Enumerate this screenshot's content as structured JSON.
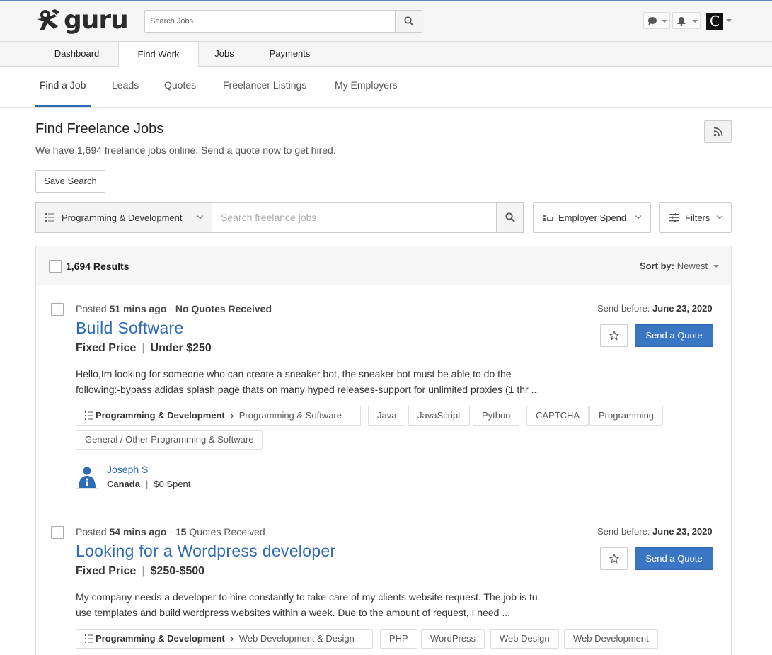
{
  "header": {
    "logo_text": "guru",
    "search_placeholder": "Search Jobs",
    "avatar_letter": "C"
  },
  "main_tabs": [
    {
      "label": "Dashboard",
      "active": false
    },
    {
      "label": "Find Work",
      "active": true
    },
    {
      "label": "Jobs",
      "active": false
    },
    {
      "label": "Payments",
      "active": false
    }
  ],
  "sub_tabs": [
    {
      "label": "Find a Job",
      "active": true
    },
    {
      "label": "Leads",
      "active": false
    },
    {
      "label": "Quotes",
      "active": false
    },
    {
      "label": "Freelancer Listings",
      "active": false
    },
    {
      "label": "My Employers",
      "active": false
    }
  ],
  "page": {
    "title": "Find Freelance Jobs",
    "subtitle": "We have 1,694 freelance jobs online. Send a quote now to get hired.",
    "save_search_label": "Save Search"
  },
  "filters": {
    "category": "Programming & Development",
    "search_placeholder": "Search freelance jobs",
    "employer_spend_label": "Employer Spend",
    "filters_label": "Filters"
  },
  "results": {
    "count_label": "1,694 Results",
    "sort_label": "Sort by:",
    "sort_value": "Newest"
  },
  "jobs": [
    {
      "posted_prefix": "Posted",
      "posted_time": "51 mins ago",
      "dot": "·",
      "quotes_count": "",
      "quotes_label": "No Quotes Received",
      "title": "Build Software",
      "price_type": "Fixed Price",
      "price_sep": "|",
      "price_range": "Under $250",
      "description_line1": "Hello,Im looking for someone who can create a sneaker bot, the sneaker bot must be able to do the",
      "description_line2": "following:-bypass adidas splash page thats on many hyped releases-support for unlimited proxies (1 thr ...",
      "send_before_label": "Send before:",
      "send_before_date": "June 23, 2020",
      "quote_button": "Send a Quote",
      "category": "Programming & Development",
      "subcategory": "Programming & Software",
      "skills": [
        "Java",
        "JavaScript",
        "Python",
        "CAPTCHA",
        "Programming",
        "General / Other Programming & Software"
      ],
      "employer_name": "Joseph S",
      "employer_country": "Canada",
      "employer_sep": "|",
      "employer_spent": "$0 Spent"
    },
    {
      "posted_prefix": "Posted",
      "posted_time": "54 mins ago",
      "dot": "·",
      "quotes_count": "15",
      "quotes_label": "Quotes Received",
      "title": "Looking for a Wordpress developer",
      "price_type": "Fixed Price",
      "price_sep": "|",
      "price_range": "$250-$500",
      "description_line1": "My company needs a developer to hire constantly to take care of my clients website request. The job is tu",
      "description_line2": "use templates and build wordpress websites within a week. Due to the amount of request, I need ...",
      "send_before_label": "Send before:",
      "send_before_date": "June 23, 2020",
      "quote_button": "Send a Quote",
      "category": "Programming & Development",
      "subcategory": "Web Development & Design",
      "skills": [
        "PHP",
        "WordPress",
        "Web Design",
        "Web Development"
      ]
    }
  ],
  "colors": {
    "link_blue": "#2d6bb5",
    "button_blue": "#3a76c4"
  }
}
